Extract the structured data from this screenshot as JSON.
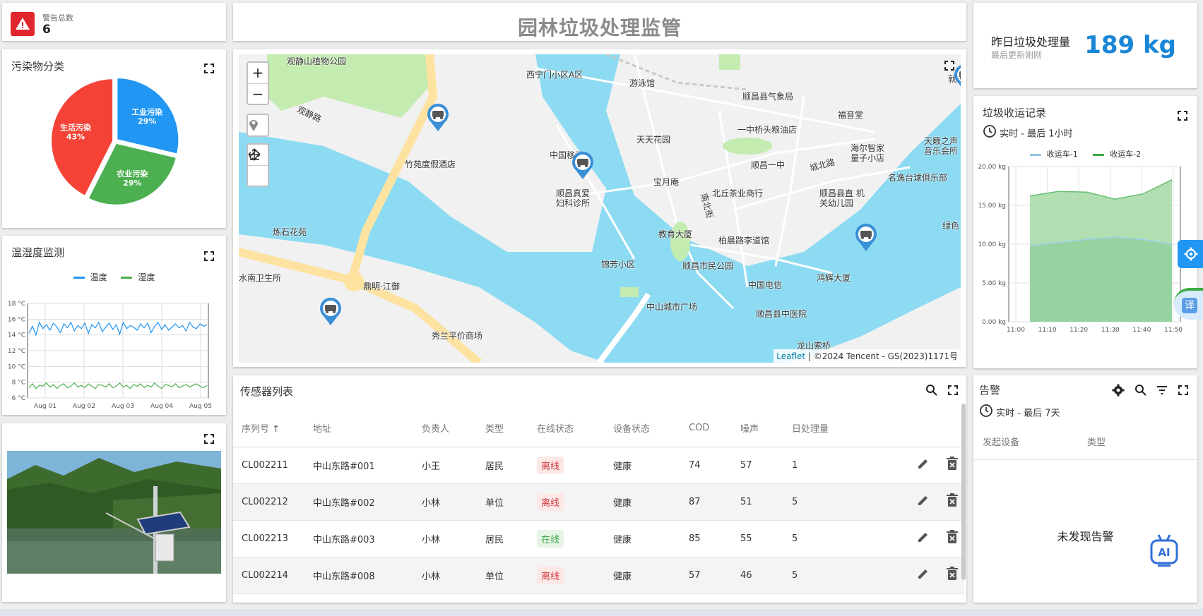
{
  "alarm_total": {
    "label": "警告总数",
    "value": "6"
  },
  "page_title": "园林垃圾处理监管",
  "pollution": {
    "title": "污染物分类",
    "chart_data": {
      "type": "pie",
      "categories": [
        "工业污染",
        "农业污染",
        "生活污染"
      ],
      "values": [
        29,
        29,
        43
      ],
      "labels": [
        "29%",
        "29%",
        "43%"
      ],
      "colors": [
        "#2196f3",
        "#4caf50",
        "#f44336"
      ]
    }
  },
  "temp_humidity": {
    "title": "温湿度监测",
    "chart_data": {
      "type": "line",
      "legend": [
        "温度",
        "湿度"
      ],
      "yticks": [
        "18 °C",
        "16 °C",
        "14 °C",
        "12 °C",
        "10 °C",
        "8 °C",
        "6 °C"
      ],
      "ylim": [
        6,
        18
      ],
      "xticks": [
        "Aug 01",
        "Aug 02",
        "Aug 03",
        "Aug 04",
        "Aug 05"
      ],
      "series": [
        {
          "name": "温度",
          "color": "#2196f3",
          "values": [
            14.2,
            15.1,
            14.0,
            15.6,
            14.8,
            15.3,
            14.6,
            15.5,
            15.0,
            14.3,
            15.4,
            14.9,
            15.6,
            14.5,
            15.2,
            14.8,
            15.5,
            14.2,
            15.3,
            14.9,
            15.6,
            14.4,
            15.0,
            15.5,
            14.7,
            15.3,
            14.1,
            15.6,
            14.8,
            15.2,
            15.0,
            14.6,
            15.4,
            14.9,
            15.5,
            14.3,
            15.1,
            15.6,
            14.7,
            15.3,
            14.6,
            15.0,
            15.4,
            14.9,
            15.2,
            14.5,
            15.6,
            15.0,
            14.8,
            15.4,
            15.1,
            15.3
          ]
        },
        {
          "name": "湿度",
          "color": "#4caf50",
          "values": [
            7.3,
            7.8,
            7.2,
            7.6,
            7.5,
            7.9,
            7.4,
            7.7,
            7.2,
            7.6,
            7.8,
            7.3,
            7.5,
            7.9,
            7.4,
            7.6,
            7.3,
            7.8,
            7.5,
            7.2,
            7.7,
            7.6,
            7.4,
            7.8,
            7.3,
            7.5,
            7.9,
            7.4,
            7.6,
            7.2,
            7.7,
            7.5,
            7.8,
            7.3,
            7.6,
            7.4,
            7.9,
            7.5,
            7.2,
            7.7,
            7.6,
            7.4,
            7.8,
            7.3,
            7.5,
            7.7,
            7.4,
            7.6,
            7.8,
            7.5,
            7.3,
            7.6
          ]
        }
      ]
    }
  },
  "map": {
    "zoom_in": "+",
    "zoom_out": "−",
    "attribution_link": "Leaflet",
    "attribution_text": " | ©2024 Tencent - GS(2023)1171号",
    "labels": [
      "观静山植物公园",
      "西宁门小区A区",
      "游泳馆",
      "顺昌县气象局",
      "福音堂",
      "一中桥头粮油店",
      "天天花园",
      "竹苑度假酒店",
      "中国移动",
      "顺昌一中",
      "海尔智家 量子小店",
      "天籁之声 音乐会所",
      "宝月庵",
      "北丘茶业商行",
      "顺昌县直 机关幼儿园",
      "名逸台球俱乐部",
      "顺昌真爱 妇科诊所",
      "炼石花苑",
      "教育大厦",
      "柏晨路李道馆",
      "锦芳小区",
      "顺昌市民公园",
      "鸿辉大厦",
      "水南卫生所",
      "鼎明·江御",
      "中国电信",
      "中山城市广场",
      "顺昌县中医院",
      "秀兰平价商场",
      "龙山索桥",
      "观静路",
      "城北路",
      "南北街",
      "就业",
      "绿色"
    ]
  },
  "sensors": {
    "title": "传感器列表",
    "columns": [
      "序列号",
      "地址",
      "负责人",
      "类型",
      "在线状态",
      "设备状态",
      "COD",
      "噪声",
      "日处理量"
    ],
    "rows": [
      [
        "CL002211",
        "中山东路#001",
        "小王",
        "居民",
        "离线",
        "健康",
        "74",
        "57",
        "1"
      ],
      [
        "CL002212",
        "中山东路#002",
        "小林",
        "单位",
        "离线",
        "健康",
        "87",
        "51",
        "5"
      ],
      [
        "CL002213",
        "中山东路#003",
        "小林",
        "居民",
        "在线",
        "健康",
        "85",
        "55",
        "5"
      ],
      [
        "CL002214",
        "中山东路#008",
        "小林",
        "单位",
        "离线",
        "健康",
        "57",
        "46",
        "5"
      ]
    ]
  },
  "yesterday": {
    "label": "昨日垃圾处理量",
    "sub": "最后更新刚刚",
    "value": "189 kg"
  },
  "collection": {
    "title": "垃圾收运记录",
    "range": "实时 - 最后 1小时",
    "chart_data": {
      "type": "area",
      "legend": [
        "收运车-1",
        "收运车-2"
      ],
      "x": [
        "11:00",
        "11:10",
        "11:20",
        "11:30",
        "11:40",
        "11:50"
      ],
      "yticks": [
        "20.00 kg",
        "15.00 kg",
        "10.00 kg",
        "5.00 kg",
        "0.00 kg"
      ],
      "ylim": [
        0,
        20
      ],
      "series": [
        {
          "name": "收运车-1",
          "color": "#90c8e8",
          "values": [
            9.8,
            10.2,
            10.6,
            10.9,
            10.6,
            10.0
          ]
        },
        {
          "name": "收运车-2",
          "color": "#7fca87",
          "values": [
            16.2,
            16.8,
            16.7,
            15.8,
            16.5,
            18.3
          ]
        }
      ]
    }
  },
  "alarms": {
    "title": "告警",
    "range": "实时 - 最后 7天",
    "columns": [
      "发起设备",
      "类型"
    ],
    "empty": "未发现告警"
  },
  "side_buttons": {
    "translate": "译",
    "ai": "AI"
  }
}
